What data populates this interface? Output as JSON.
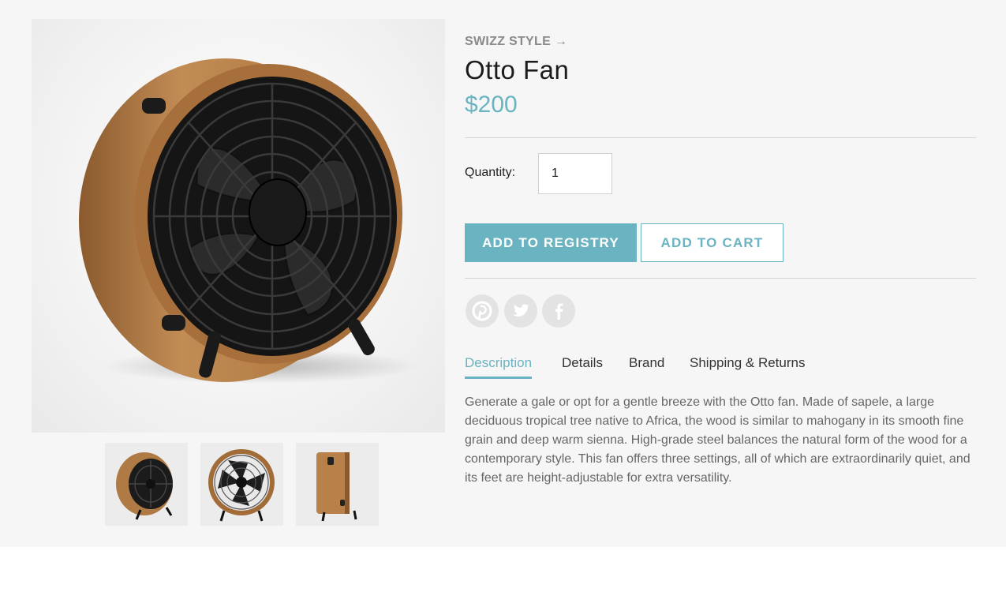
{
  "product": {
    "brand_link": "SWIZZ STYLE →",
    "name": "Otto Fan",
    "price": "$200"
  },
  "purchase": {
    "quantity_label": "Quantity:",
    "quantity_value": "1",
    "add_to_registry_label": "ADD TO REGISTRY",
    "add_to_cart_label": "ADD TO CART"
  },
  "social": [
    "pinterest-icon",
    "twitter-icon",
    "facebook-icon"
  ],
  "tabs": [
    {
      "label": "Description",
      "active": true
    },
    {
      "label": "Details",
      "active": false
    },
    {
      "label": "Brand",
      "active": false
    },
    {
      "label": "Shipping & Returns",
      "active": false
    }
  ],
  "description": "Generate a gale or opt for a gentle breeze with the Otto fan. Made of sapele, a large deciduous tropical tree native to Africa, the wood is similar to mahogany in its smooth fine grain and deep warm sienna. High-grade steel balances the natural form of the wood for a contemporary style. This fan offers three settings, all of which are extraordinarily quiet, and its feet are height-adjustable for extra versatility.",
  "colors": {
    "accent": "#6ab3c0",
    "wood": "#b07a45",
    "background": "#f6f6f6"
  }
}
